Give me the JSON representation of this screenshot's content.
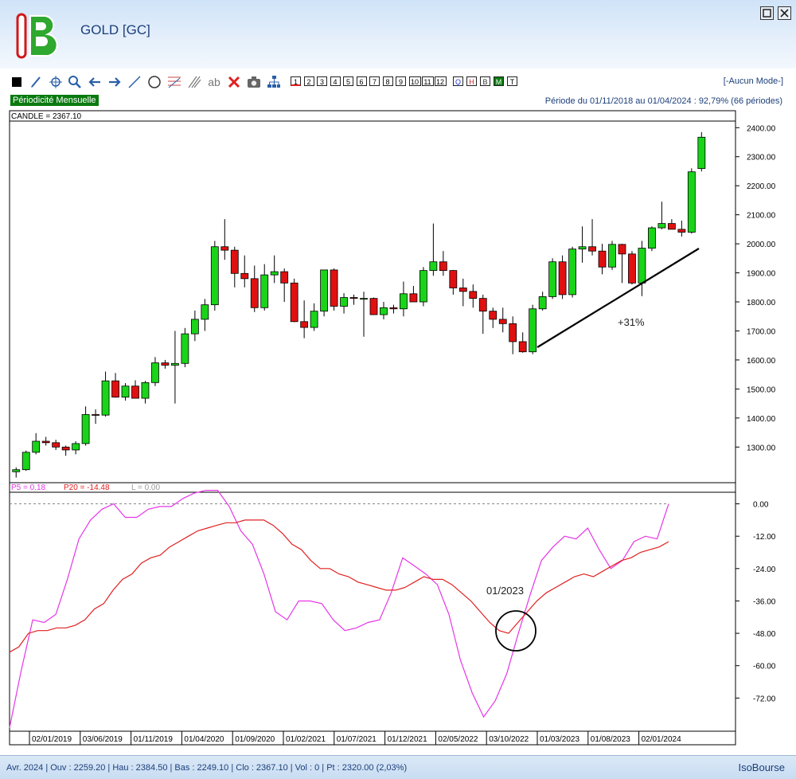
{
  "window": {
    "title": "GOLD [GC]",
    "brand": "IsoBourse"
  },
  "toolbar": {
    "timeframes": [
      "1",
      "2",
      "3",
      "4",
      "5",
      "6",
      "7",
      "8",
      "9",
      "10",
      "11",
      "12"
    ],
    "period_buttons": [
      "Q",
      "H",
      "B",
      "M",
      "T"
    ],
    "mode": "[-Aucun Mode-]",
    "tools": [
      "square-icon",
      "pen-icon",
      "crosshair-icon",
      "zoom-icon",
      "arrow-left-icon",
      "arrow-right-icon",
      "line-icon",
      "circle-icon",
      "fan-icon",
      "channel-icon",
      "text-icon",
      "delete-icon",
      "camera-icon",
      "hierarchy-icon"
    ],
    "text_tool_label": "ab"
  },
  "header": {
    "periodicity": "Périodicité Mensuelle",
    "period": "Période du 01/11/2018 au 01/04/2024 : 92,79% (66 périodes)"
  },
  "status": {
    "text": "Avr. 2024 | Ouv : 2259.20 | Hau : 2384.50 | Bas : 2249.10 | Clo : 2367.10 | Vol : 0 | Pt : 2320.00 (2,03%)"
  },
  "colors": {
    "up": "#19d419",
    "down": "#e01010",
    "p5": "#e636e6",
    "p20": "#e02020",
    "zero_ref": "#888888"
  },
  "chart_data": [
    {
      "type": "candlestick",
      "legend": "CANDLE = 2367.10",
      "ylim": [
        1180,
        2420
      ],
      "yticks": [
        "2400.00",
        "2300.00",
        "2200.00",
        "2100.00",
        "2000.00",
        "1900.00",
        "1800.00",
        "1700.00",
        "1600.00",
        "1500.00",
        "1400.00",
        "1300.00"
      ],
      "series": [
        {
          "ohlc": [
            [
              1215,
              1230,
              1195,
              1222
            ],
            [
              1222,
              1288,
              1218,
              1282
            ],
            [
              1282,
              1348,
              1275,
              1320
            ],
            [
              1320,
              1335,
              1305,
              1315
            ],
            [
              1315,
              1325,
              1290,
              1300
            ],
            [
              1300,
              1305,
              1270,
              1290
            ],
            [
              1290,
              1320,
              1275,
              1312
            ],
            [
              1312,
              1440,
              1305,
              1412
            ],
            [
              1412,
              1430,
              1380,
              1410
            ],
            [
              1410,
              1560,
              1405,
              1528
            ],
            [
              1528,
              1555,
              1470,
              1472
            ],
            [
              1472,
              1520,
              1460,
              1510
            ],
            [
              1510,
              1530,
              1470,
              1468
            ],
            [
              1468,
              1528,
              1450,
              1522
            ],
            [
              1522,
              1610,
              1510,
              1590
            ],
            [
              1590,
              1600,
              1570,
              1582
            ],
            [
              1582,
              1700,
              1450,
              1588
            ],
            [
              1588,
              1710,
              1575,
              1690
            ],
            [
              1690,
              1770,
              1665,
              1740
            ],
            [
              1740,
              1810,
              1700,
              1790
            ],
            [
              1790,
              2010,
              1770,
              1990
            ],
            [
              1990,
              2085,
              1945,
              1978
            ],
            [
              1978,
              1990,
              1850,
              1898
            ],
            [
              1898,
              1960,
              1850,
              1880
            ],
            [
              1880,
              1925,
              1765,
              1780
            ],
            [
              1780,
              1930,
              1770,
              1893
            ],
            [
              1893,
              1960,
              1865,
              1904
            ],
            [
              1904,
              1915,
              1800,
              1865
            ],
            [
              1865,
              1880,
              1730,
              1732
            ],
            [
              1732,
              1805,
              1675,
              1712
            ],
            [
              1712,
              1795,
              1700,
              1768
            ],
            [
              1768,
              1910,
              1750,
              1910
            ],
            [
              1910,
              1915,
              1770,
              1785
            ],
            [
              1785,
              1830,
              1760,
              1815
            ],
            [
              1815,
              1825,
              1790,
              1812
            ],
            [
              1812,
              1835,
              1680,
              1812
            ],
            [
              1812,
              1815,
              1755,
              1756
            ],
            [
              1756,
              1800,
              1740,
              1780
            ],
            [
              1780,
              1790,
              1760,
              1776
            ],
            [
              1776,
              1870,
              1750,
              1828
            ],
            [
              1828,
              1855,
              1815,
              1800
            ],
            [
              1800,
              1920,
              1785,
              1908
            ],
            [
              1908,
              2070,
              1890,
              1938
            ],
            [
              1938,
              1975,
              1890,
              1908
            ],
            [
              1908,
              1910,
              1825,
              1848
            ],
            [
              1848,
              1880,
              1785,
              1836
            ],
            [
              1836,
              1860,
              1780,
              1812
            ],
            [
              1812,
              1825,
              1690,
              1768
            ],
            [
              1768,
              1780,
              1710,
              1740
            ],
            [
              1740,
              1780,
              1695,
              1725
            ],
            [
              1725,
              1750,
              1620,
              1663
            ],
            [
              1663,
              1695,
              1625,
              1628
            ],
            [
              1628,
              1790,
              1620,
              1776
            ],
            [
              1776,
              1835,
              1770,
              1818
            ],
            [
              1818,
              1950,
              1810,
              1938
            ],
            [
              1938,
              1960,
              1810,
              1825
            ],
            [
              1825,
              1990,
              1815,
              1982
            ],
            [
              1982,
              2060,
              1935,
              1990
            ],
            [
              1990,
              2085,
              1960,
              1975
            ],
            [
              1975,
              2000,
              1895,
              1920
            ],
            [
              1920,
              2010,
              1910,
              1998
            ],
            [
              1998,
              2000,
              1865,
              1965
            ],
            [
              1965,
              1975,
              1860,
              1865
            ],
            [
              1865,
              2010,
              1820,
              1985
            ],
            [
              1985,
              2060,
              1975,
              2055
            ],
            [
              2055,
              2145,
              2050,
              2070
            ],
            [
              2070,
              2085,
              2055,
              2050
            ],
            [
              2050,
              2080,
              2025,
              2040
            ],
            [
              2040,
              2260,
              2035,
              2248
            ],
            [
              2259.2,
              2384.5,
              2249.1,
              2367.1
            ]
          ]
        }
      ],
      "annotations": {
        "trend_label": "+31%"
      }
    },
    {
      "type": "line",
      "legend": [
        "P5 = 0.18",
        "P20 = -14.48",
        "L = 0.00"
      ],
      "ylim": [
        -84,
        4
      ],
      "yticks": [
        "0.00",
        "-12.00",
        "-24.00",
        "-36.00",
        "-48.00",
        "-60.00",
        "-72.00"
      ],
      "x_labels": [
        "02/01/2019",
        "03/06/2019",
        "01/11/2019",
        "01/04/2020",
        "01/09/2020",
        "01/02/2021",
        "01/07/2021",
        "01/12/2021",
        "02/05/2022",
        "03/10/2022",
        "01/03/2023",
        "01/08/2023",
        "02/01/2024"
      ],
      "series": [
        {
          "name": "P5",
          "values": [
            -83,
            -62,
            -43,
            -44,
            -41,
            -28,
            -13,
            -6,
            -2,
            0,
            -5,
            -5,
            -2,
            -1,
            -1,
            2,
            4,
            5,
            5,
            -1,
            -10,
            -15,
            -26,
            -40,
            -43,
            -36,
            -36,
            -37,
            -43,
            -47,
            -46,
            -44,
            -43,
            -33,
            -20,
            -23,
            -26,
            -30,
            -41,
            -58,
            -70,
            -79,
            -73,
            -63,
            -48,
            -34,
            -21,
            -16,
            -12,
            -13,
            -9,
            -17,
            -24,
            -21,
            -14,
            -12,
            -13,
            0
          ]
        },
        {
          "name": "P20",
          "values": [
            -55,
            -53,
            -48,
            -47,
            -47,
            -46,
            -46,
            -45,
            -43,
            -39,
            -37,
            -32,
            -28,
            -26,
            -22,
            -20,
            -19,
            -16,
            -14,
            -12,
            -10,
            -9,
            -8,
            -7,
            -7,
            -6,
            -6,
            -6,
            -8,
            -11,
            -15,
            -17,
            -21,
            -24,
            -24,
            -26,
            -27,
            -29,
            -30,
            -31,
            -32,
            -32,
            -31,
            -29,
            -27,
            -28,
            -28,
            -30,
            -33,
            -36,
            -40,
            -44,
            -47,
            -48,
            -44,
            -40,
            -36,
            -33,
            -31,
            -29,
            -27,
            -26,
            -27,
            -25,
            -23,
            -21,
            -20,
            -18,
            -17,
            -16,
            -14
          ]
        }
      ],
      "annotations": {
        "circle_label": "01/2023"
      }
    }
  ]
}
